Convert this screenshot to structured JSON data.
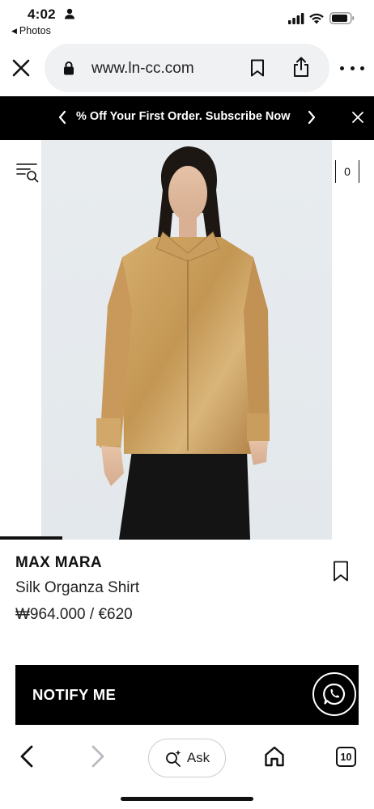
{
  "status_bar": {
    "time": "4:02",
    "back_app": "Photos",
    "back_arrow": "◀",
    "icons": [
      "person-icon",
      "signal-icon",
      "wifi-icon",
      "battery-icon"
    ]
  },
  "browser": {
    "url": "www.ln-cc.com",
    "icons": [
      "close-icon",
      "lock-icon",
      "bookmark-icon",
      "share-icon",
      "more-icon"
    ]
  },
  "promo": {
    "text": "% Off Your First Order. Subscribe Now",
    "icons": [
      "chevron-left-icon",
      "chevron-right-icon",
      "close-icon"
    ]
  },
  "header": {
    "cart_count": "0",
    "icons": [
      "menu-search-icon"
    ]
  },
  "product": {
    "brand": "MAX MARA",
    "name": "Silk Organza Shirt",
    "price": "₩964.000 / €620",
    "notify_label": "NOTIFY ME",
    "image_description_colors": {
      "background": "#e6ebee",
      "shirt": "#c49a5c",
      "trousers": "#141414"
    }
  },
  "toolbar": {
    "ask_label": "Ask",
    "tabs_count": "10",
    "icons": [
      "back-icon",
      "forward-icon",
      "sparkle-search-icon",
      "home-icon"
    ]
  }
}
